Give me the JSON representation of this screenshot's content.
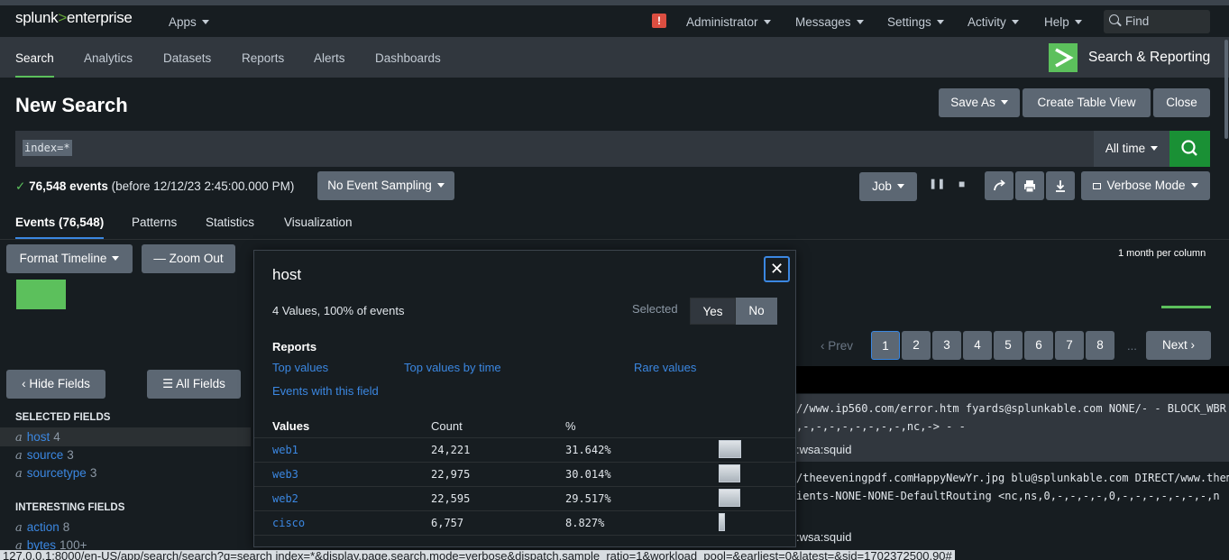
{
  "topbar": {
    "logo_splunk": "splunk",
    "logo_gt": ">",
    "logo_enterprise": "enterprise",
    "apps": "Apps",
    "alert_badge": "!",
    "administrator": "Administrator",
    "messages": "Messages",
    "settings": "Settings",
    "activity": "Activity",
    "help": "Help",
    "find_placeholder": "Find"
  },
  "appbar": {
    "tabs": [
      "Search",
      "Analytics",
      "Datasets",
      "Reports",
      "Alerts",
      "Dashboards"
    ],
    "app_name": "Search & Reporting",
    "accent": "#5cc05c"
  },
  "header": {
    "title": "New Search",
    "save_as": "Save As",
    "create_table_view": "Create Table View",
    "close": "Close"
  },
  "search": {
    "query": "index=*",
    "time_range": "All time"
  },
  "status": {
    "check": "✓",
    "count": "76,548 events",
    "detail": "(before 12/12/23 2:45:00.000 PM)",
    "sampling": "No Event Sampling",
    "job": "Job",
    "mode": "Verbose Mode"
  },
  "tabs": [
    "Events (76,548)",
    "Patterns",
    "Statistics",
    "Visualization"
  ],
  "timeline": {
    "format": "Format Timeline",
    "zoom_out": "— Zoom Out",
    "scale": "1 month per column"
  },
  "pagination": {
    "prev": "‹ Prev",
    "pages": [
      "1",
      "2",
      "3",
      "4",
      "5",
      "6",
      "7",
      "8"
    ],
    "current": "1",
    "ellipsis": "...",
    "next": "Next ›"
  },
  "fields": {
    "hide": "Hide Fields",
    "all": "All Fields",
    "selected_header": "SELECTED FIELDS",
    "selected": [
      {
        "type": "a",
        "name": "host",
        "count": "4"
      },
      {
        "type": "a",
        "name": "source",
        "count": "3"
      },
      {
        "type": "a",
        "name": "sourcetype",
        "count": "3"
      }
    ],
    "interesting_header": "INTERESTING FIELDS",
    "interesting": [
      {
        "type": "a",
        "name": "action",
        "count": "8"
      },
      {
        "type": "a",
        "name": "bytes",
        "count": "100+"
      }
    ]
  },
  "events": {
    "lines": [
      "//www.ip560.com/error.htm fyards@splunkable.com NONE/- - BLOCK_WBR",
      ",-,-,-,-,-,-,-,-,nc,-> - -",
      ":wsa:squid",
      "/theeveningpdf.comHappyNewYr.jpg blu@splunkable.com DIRECT/www.them",
      "ients-NONE-NONE-DefaultRouting <nc,ns,0,-,-,-,-,0,-,-,-,-,-,-,-,n",
      ":wsa:squid"
    ]
  },
  "popup": {
    "title": "host",
    "close": "✕",
    "summary": "4 Values, 100% of events",
    "selected_label": "Selected",
    "yes": "Yes",
    "no": "No",
    "reports_header": "Reports",
    "top_values": "Top values",
    "top_values_by_time": "Top values by time",
    "rare_values": "Rare values",
    "events_with_field": "Events with this field",
    "col_values": "Values",
    "col_count": "Count",
    "col_pct": "%",
    "rows": [
      {
        "value": "web1",
        "count": "24,221",
        "pct": "31.642%",
        "fraction": 0.31642
      },
      {
        "value": "web3",
        "count": "22,975",
        "pct": "30.014%",
        "fraction": 0.30014
      },
      {
        "value": "web2",
        "count": "22,595",
        "pct": "29.517%",
        "fraction": 0.29517
      },
      {
        "value": "cisco",
        "count": "6,757",
        "pct": "8.827%",
        "fraction": 0.08827
      }
    ]
  },
  "url": "127.0.0.1:8000/en-US/app/search/search?q=search index=*&display.page.search.mode=verbose&dispatch.sample_ratio=1&workload_pool=&earliest=0&latest=&sid=1702372500.90#"
}
